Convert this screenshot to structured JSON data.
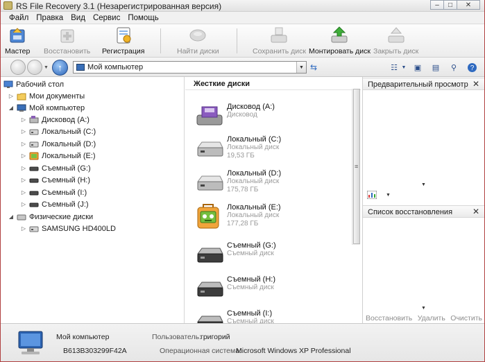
{
  "window": {
    "title": "RS File Recovery 3.1 (Незарегистрированная версия)",
    "minimize": "–",
    "maximize": "□",
    "close": "✕"
  },
  "menu": [
    "Файл",
    "Правка",
    "Вид",
    "Сервис",
    "Помощь"
  ],
  "toolbar": {
    "wizard": "Мастер",
    "restore": "Восстановить",
    "register": "Регистрация",
    "find_disks": "Найти диски",
    "save_disk": "Сохранить диск",
    "mount_disk": "Монтировать диск",
    "close_disk": "Закрыть диск"
  },
  "address": {
    "value": "Мой компьютер"
  },
  "tree": {
    "desktop": "Рабочий стол",
    "my_documents": "Мои документы",
    "my_computer": "Мой компьютер",
    "drives": [
      {
        "label": "Дисковод (A:)",
        "icon": "floppy-icon"
      },
      {
        "label": "Локальный (C:)",
        "icon": "hdd-icon"
      },
      {
        "label": "Локальный (D:)",
        "icon": "hdd-icon"
      },
      {
        "label": "Локальный (E:)",
        "icon": "robot-drive-icon"
      },
      {
        "label": "Съемный (G:)",
        "icon": "removable-icon"
      },
      {
        "label": "Съемный (H:)",
        "icon": "removable-icon"
      },
      {
        "label": "Съемный (I:)",
        "icon": "removable-icon"
      },
      {
        "label": "Съемный (J:)",
        "icon": "removable-icon"
      }
    ],
    "physical": "Физические диски",
    "physical_disks": [
      "SAMSUNG HD400LD"
    ]
  },
  "center": {
    "heading": "Жесткие диски",
    "drives": [
      {
        "name": "Дисковод (A:)",
        "type": "Дисковод",
        "size": ""
      },
      {
        "name": "Локальный (C:)",
        "type": "Локальный диск",
        "size": "19,53 ГБ"
      },
      {
        "name": "Локальный (D:)",
        "type": "Локальный диск",
        "size": "175,78 ГБ"
      },
      {
        "name": "Локальный (E:)",
        "type": "Локальный диск",
        "size": "177,28 ГБ"
      },
      {
        "name": "Съемный (G:)",
        "type": "Съемный диск",
        "size": ""
      },
      {
        "name": "Съемный (H:)",
        "type": "Съемный диск",
        "size": ""
      },
      {
        "name": "Съемный (I:)",
        "type": "Съемный диск",
        "size": ""
      }
    ]
  },
  "right": {
    "preview_title": "Предварительный просмотр",
    "recovery_title": "Список восстановления",
    "restore": "Восстановить",
    "delete": "Удалить",
    "clear": "Очистить"
  },
  "status": {
    "computer": "Мой компьютер",
    "id": "B613B303299F42A",
    "user_label": "Пользователь:",
    "user": "григорий",
    "os_label": "Операционная система:",
    "os": "Microsoft Windows XP Professional"
  }
}
